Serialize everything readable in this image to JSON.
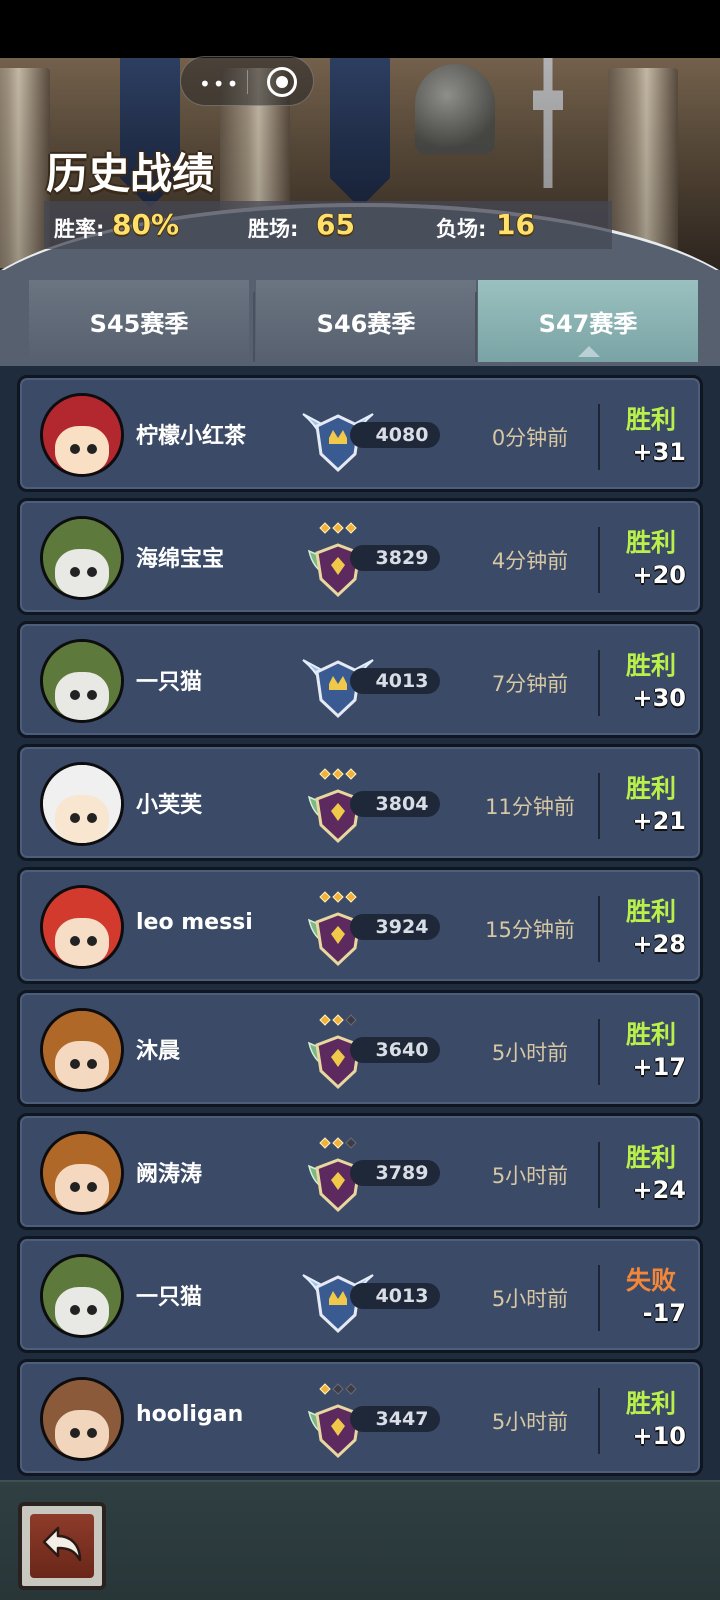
{
  "header": {
    "title": "历史战绩",
    "stats": [
      {
        "label": "胜率:",
        "value": "80%"
      },
      {
        "label": "胜场:",
        "value": "65"
      },
      {
        "label": "负场:",
        "value": "16"
      }
    ]
  },
  "tabs": [
    {
      "label": "S45赛季",
      "active": false
    },
    {
      "label": "S46赛季",
      "active": false
    },
    {
      "label": "S47赛季",
      "active": true
    }
  ],
  "matches": [
    {
      "name": "柠檬小红茶",
      "rating": "4080",
      "time": "0分钟前",
      "result": "胜利",
      "delta": "+31",
      "badge": "winged",
      "avatar": "red-hat"
    },
    {
      "name": "海绵宝宝",
      "rating": "3829",
      "time": "4分钟前",
      "result": "胜利",
      "delta": "+20",
      "badge": "stars-3",
      "avatar": "green-raccoon"
    },
    {
      "name": "一只猫",
      "rating": "4013",
      "time": "7分钟前",
      "result": "胜利",
      "delta": "+30",
      "badge": "winged",
      "avatar": "green-raccoon"
    },
    {
      "name": "小芙芙",
      "rating": "3804",
      "time": "11分钟前",
      "result": "胜利",
      "delta": "+21",
      "badge": "stars-3",
      "avatar": "panda-hood"
    },
    {
      "name": "leo messi",
      "rating": "3924",
      "time": "15分钟前",
      "result": "胜利",
      "delta": "+28",
      "badge": "stars-3",
      "avatar": "strawberry"
    },
    {
      "name": "沐晨",
      "rating": "3640",
      "time": "5小时前",
      "result": "胜利",
      "delta": "+17",
      "badge": "stars-2",
      "avatar": "pumpkin"
    },
    {
      "name": "阙涛涛",
      "rating": "3789",
      "time": "5小时前",
      "result": "胜利",
      "delta": "+24",
      "badge": "stars-2",
      "avatar": "pumpkin"
    },
    {
      "name": "一只猫",
      "rating": "4013",
      "time": "5小时前",
      "result": "失败",
      "delta": "-17",
      "badge": "winged",
      "avatar": "green-raccoon"
    },
    {
      "name": "hooligan",
      "rating": "3447",
      "time": "5小时前",
      "result": "胜利",
      "delta": "+10",
      "badge": "stars-1",
      "avatar": "braided"
    }
  ],
  "icons": {
    "back": "back-arrow-icon",
    "capsule_menu": "more-dots-icon",
    "capsule_close": "target-circle-icon"
  },
  "colors": {
    "win": "#b9f04a",
    "loss": "#f2873a",
    "stat_value": "#ffe06a",
    "card_bg": "#3b4a66",
    "active_tab": "#8fb6b6"
  }
}
